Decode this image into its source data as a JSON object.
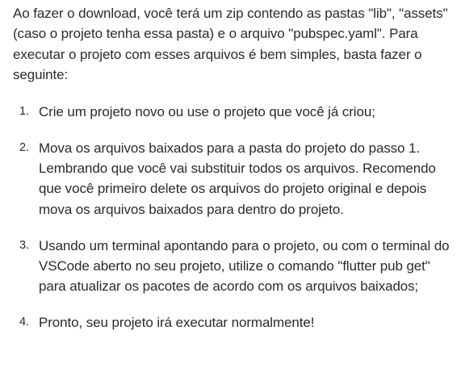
{
  "intro": "Ao fazer o download, você terá um zip contendo as pastas \"lib\", \"assets\" (caso o projeto tenha essa pasta) e o arquivo \"pubspec.yaml\". Para executar o projeto com esses arquivos é bem simples, basta fazer o seguinte:",
  "steps": [
    {
      "number": "1.",
      "text": "Crie um projeto novo ou use o projeto que você já criou;"
    },
    {
      "number": "2.",
      "text": "Mova os arquivos baixados para a pasta do projeto do passo 1. Lembrando que você vai substituir todos os arquivos. Recomendo que você primeiro delete os arquivos do projeto original e depois mova os arquivos baixados para dentro do projeto."
    },
    {
      "number": "3.",
      "text": "Usando um terminal apontando para o projeto, ou com o terminal do VSCode aberto no seu projeto, utilize o comando \"flutter pub get\" para atualizar os pacotes de acordo com os arquivos baixados;"
    },
    {
      "number": "4.",
      "text": "Pronto, seu projeto irá executar normalmente!"
    }
  ]
}
